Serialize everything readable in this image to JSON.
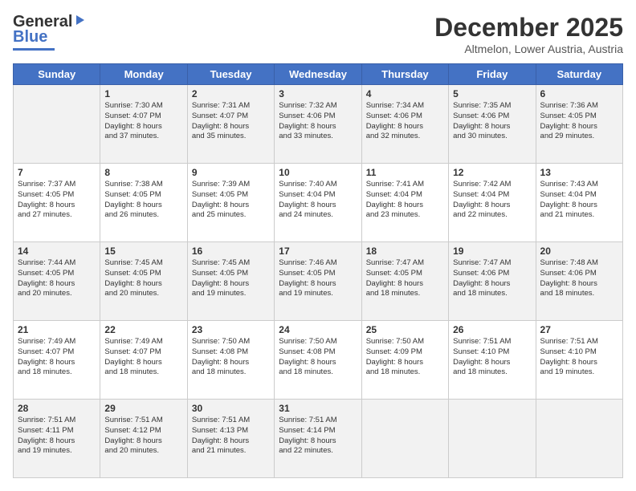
{
  "header": {
    "logo_line1": "General",
    "logo_line2": "Blue",
    "month": "December 2025",
    "location": "Altmelon, Lower Austria, Austria"
  },
  "days_header": [
    "Sunday",
    "Monday",
    "Tuesday",
    "Wednesday",
    "Thursday",
    "Friday",
    "Saturday"
  ],
  "weeks": [
    [
      {
        "num": "",
        "info": ""
      },
      {
        "num": "1",
        "info": "Sunrise: 7:30 AM\nSunset: 4:07 PM\nDaylight: 8 hours\nand 37 minutes."
      },
      {
        "num": "2",
        "info": "Sunrise: 7:31 AM\nSunset: 4:07 PM\nDaylight: 8 hours\nand 35 minutes."
      },
      {
        "num": "3",
        "info": "Sunrise: 7:32 AM\nSunset: 4:06 PM\nDaylight: 8 hours\nand 33 minutes."
      },
      {
        "num": "4",
        "info": "Sunrise: 7:34 AM\nSunset: 4:06 PM\nDaylight: 8 hours\nand 32 minutes."
      },
      {
        "num": "5",
        "info": "Sunrise: 7:35 AM\nSunset: 4:06 PM\nDaylight: 8 hours\nand 30 minutes."
      },
      {
        "num": "6",
        "info": "Sunrise: 7:36 AM\nSunset: 4:05 PM\nDaylight: 8 hours\nand 29 minutes."
      }
    ],
    [
      {
        "num": "7",
        "info": "Sunrise: 7:37 AM\nSunset: 4:05 PM\nDaylight: 8 hours\nand 27 minutes."
      },
      {
        "num": "8",
        "info": "Sunrise: 7:38 AM\nSunset: 4:05 PM\nDaylight: 8 hours\nand 26 minutes."
      },
      {
        "num": "9",
        "info": "Sunrise: 7:39 AM\nSunset: 4:05 PM\nDaylight: 8 hours\nand 25 minutes."
      },
      {
        "num": "10",
        "info": "Sunrise: 7:40 AM\nSunset: 4:04 PM\nDaylight: 8 hours\nand 24 minutes."
      },
      {
        "num": "11",
        "info": "Sunrise: 7:41 AM\nSunset: 4:04 PM\nDaylight: 8 hours\nand 23 minutes."
      },
      {
        "num": "12",
        "info": "Sunrise: 7:42 AM\nSunset: 4:04 PM\nDaylight: 8 hours\nand 22 minutes."
      },
      {
        "num": "13",
        "info": "Sunrise: 7:43 AM\nSunset: 4:04 PM\nDaylight: 8 hours\nand 21 minutes."
      }
    ],
    [
      {
        "num": "14",
        "info": "Sunrise: 7:44 AM\nSunset: 4:05 PM\nDaylight: 8 hours\nand 20 minutes."
      },
      {
        "num": "15",
        "info": "Sunrise: 7:45 AM\nSunset: 4:05 PM\nDaylight: 8 hours\nand 20 minutes."
      },
      {
        "num": "16",
        "info": "Sunrise: 7:45 AM\nSunset: 4:05 PM\nDaylight: 8 hours\nand 19 minutes."
      },
      {
        "num": "17",
        "info": "Sunrise: 7:46 AM\nSunset: 4:05 PM\nDaylight: 8 hours\nand 19 minutes."
      },
      {
        "num": "18",
        "info": "Sunrise: 7:47 AM\nSunset: 4:05 PM\nDaylight: 8 hours\nand 18 minutes."
      },
      {
        "num": "19",
        "info": "Sunrise: 7:47 AM\nSunset: 4:06 PM\nDaylight: 8 hours\nand 18 minutes."
      },
      {
        "num": "20",
        "info": "Sunrise: 7:48 AM\nSunset: 4:06 PM\nDaylight: 8 hours\nand 18 minutes."
      }
    ],
    [
      {
        "num": "21",
        "info": "Sunrise: 7:49 AM\nSunset: 4:07 PM\nDaylight: 8 hours\nand 18 minutes."
      },
      {
        "num": "22",
        "info": "Sunrise: 7:49 AM\nSunset: 4:07 PM\nDaylight: 8 hours\nand 18 minutes."
      },
      {
        "num": "23",
        "info": "Sunrise: 7:50 AM\nSunset: 4:08 PM\nDaylight: 8 hours\nand 18 minutes."
      },
      {
        "num": "24",
        "info": "Sunrise: 7:50 AM\nSunset: 4:08 PM\nDaylight: 8 hours\nand 18 minutes."
      },
      {
        "num": "25",
        "info": "Sunrise: 7:50 AM\nSunset: 4:09 PM\nDaylight: 8 hours\nand 18 minutes."
      },
      {
        "num": "26",
        "info": "Sunrise: 7:51 AM\nSunset: 4:10 PM\nDaylight: 8 hours\nand 18 minutes."
      },
      {
        "num": "27",
        "info": "Sunrise: 7:51 AM\nSunset: 4:10 PM\nDaylight: 8 hours\nand 19 minutes."
      }
    ],
    [
      {
        "num": "28",
        "info": "Sunrise: 7:51 AM\nSunset: 4:11 PM\nDaylight: 8 hours\nand 19 minutes."
      },
      {
        "num": "29",
        "info": "Sunrise: 7:51 AM\nSunset: 4:12 PM\nDaylight: 8 hours\nand 20 minutes."
      },
      {
        "num": "30",
        "info": "Sunrise: 7:51 AM\nSunset: 4:13 PM\nDaylight: 8 hours\nand 21 minutes."
      },
      {
        "num": "31",
        "info": "Sunrise: 7:51 AM\nSunset: 4:14 PM\nDaylight: 8 hours\nand 22 minutes."
      },
      {
        "num": "",
        "info": ""
      },
      {
        "num": "",
        "info": ""
      },
      {
        "num": "",
        "info": ""
      }
    ]
  ]
}
